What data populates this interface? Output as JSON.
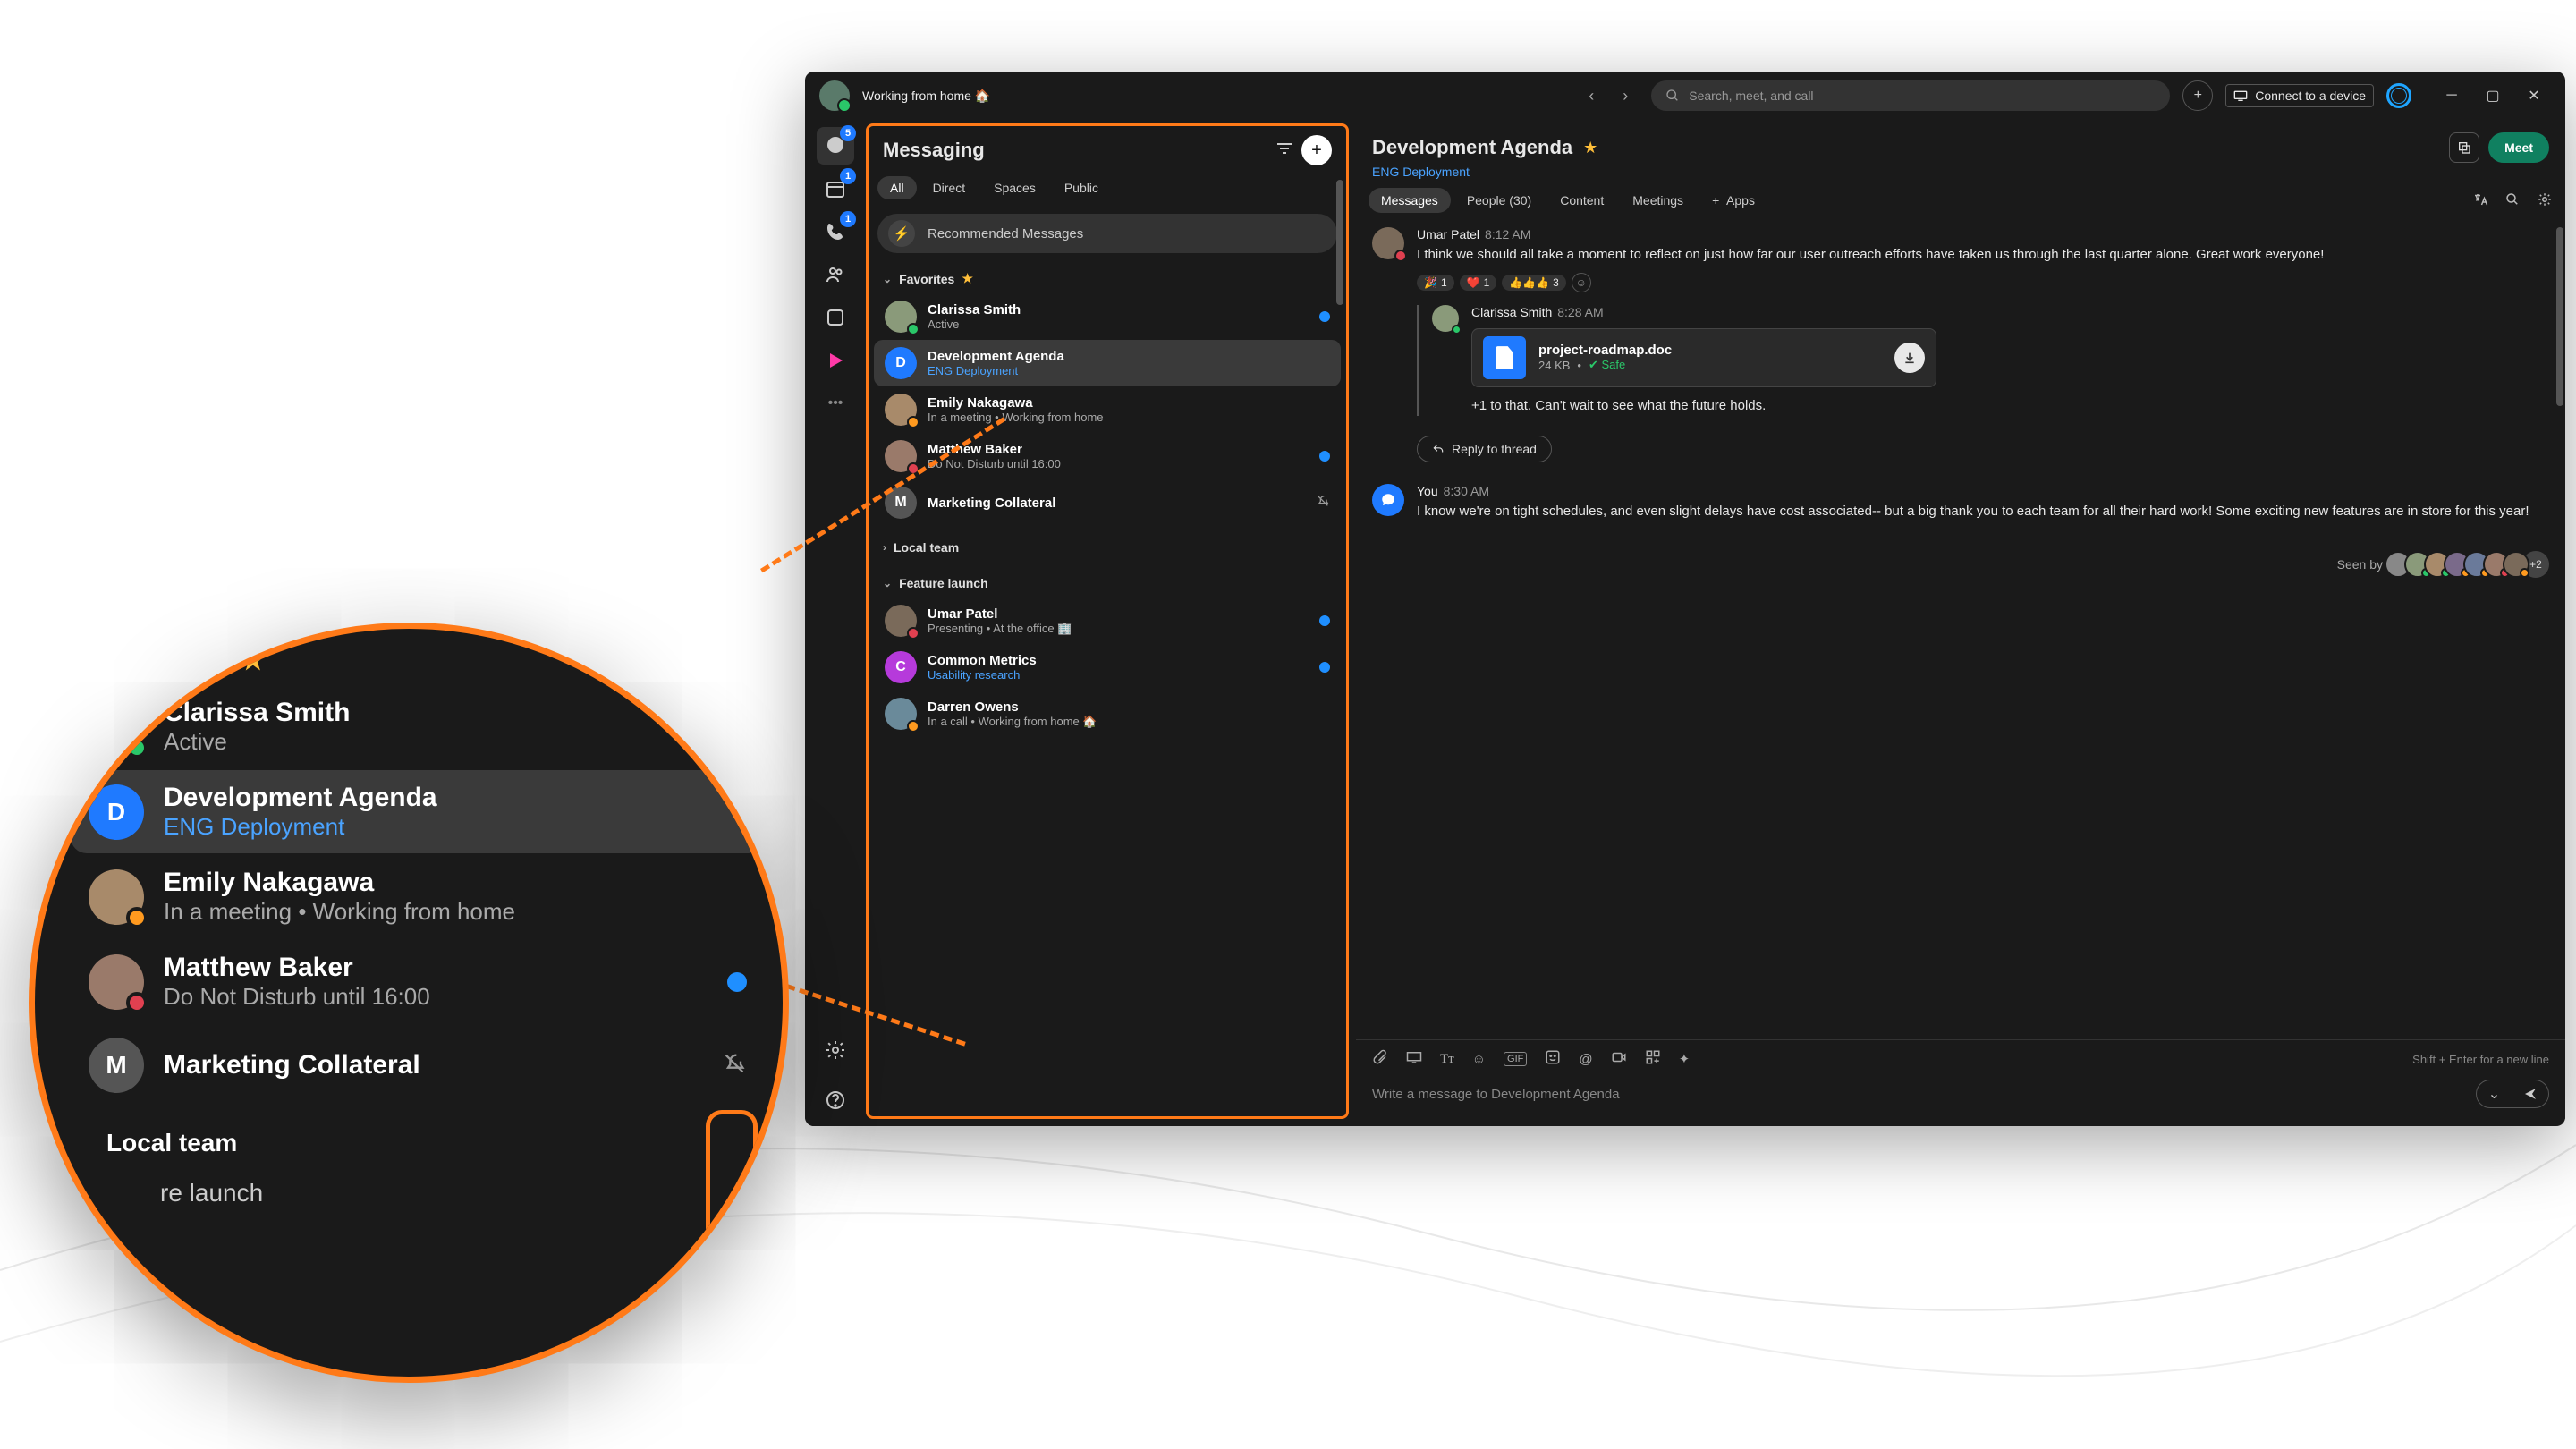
{
  "titlebar": {
    "status": "Working from home",
    "status_emoji": "🏠",
    "search_placeholder": "Search, meet, and call",
    "connect_label": "Connect to a device"
  },
  "rail": {
    "chat_badge": "5",
    "meetings_badge": "1",
    "calls_badge": "1"
  },
  "messaging": {
    "title": "Messaging",
    "tabs": {
      "all": "All",
      "direct": "Direct",
      "spaces": "Spaces",
      "public": "Public"
    },
    "recommended": "Recommended Messages",
    "sections": {
      "favorites": "Favorites",
      "local_team": "Local team",
      "feature_launch": "Feature launch"
    },
    "favorites": [
      {
        "name": "Clarissa Smith",
        "sub": "Active",
        "presence": "green"
      },
      {
        "name": "Development Agenda",
        "sub": "ENG Deployment",
        "sublink": true,
        "avatar_letter": "D",
        "avatar_color": "blue",
        "selected": true
      },
      {
        "name": "Emily Nakagawa",
        "sub": "In a meeting  •  Working from home",
        "presence": "orange"
      },
      {
        "name": "Matthew Baker",
        "sub": "Do Not Disturb until 16:00",
        "presence": "red",
        "dot": true
      },
      {
        "name": "Marketing Collateral",
        "sub": "",
        "avatar_letter": "M",
        "avatar_color": "gray",
        "muted": true
      }
    ],
    "feature_launch": [
      {
        "name": "Umar Patel",
        "sub": "Presenting  •  At the office 🏢",
        "presence": "red",
        "dot": true
      },
      {
        "name": "Common Metrics",
        "sub": "Usability research",
        "sublink": true,
        "avatar_letter": "C",
        "avatar_color": "purple",
        "dot": true
      },
      {
        "name": "Darren Owens",
        "sub": "In a call  •  Working from home 🏠",
        "presence": "orange"
      }
    ]
  },
  "conversation": {
    "title": "Development Agenda",
    "subtitle": "ENG Deployment",
    "meet_label": "Meet",
    "tabs": {
      "messages": "Messages",
      "people": "People (30)",
      "content": "Content",
      "meetings": "Meetings",
      "apps": "Apps"
    },
    "msg1": {
      "sender": "Umar Patel",
      "time": "8:12 AM",
      "text": "I think we should all take a moment to reflect on just how far our user outreach efforts have taken us through the last quarter alone. Great work everyone!",
      "reactions": [
        {
          "emoji": "🎉",
          "count": "1"
        },
        {
          "emoji": "❤️",
          "count": "1"
        },
        {
          "emoji": "👍👍👍",
          "count": "3"
        }
      ]
    },
    "reply1": {
      "sender": "Clarissa Smith",
      "time": "8:28 AM",
      "file": {
        "name": "project-roadmap.doc",
        "size": "24 KB",
        "safe_label": "Safe"
      },
      "text": "+1 to that. Can't wait to see what the future holds."
    },
    "reply_button": "Reply to thread",
    "msg2": {
      "sender": "You",
      "time": "8:30 AM",
      "text": "I know we're on tight schedules, and even slight delays have cost associated-- but a big thank you to each team for all their hard work! Some exciting new features are in store for this year!"
    },
    "seen_label": "Seen by",
    "seen_more": "+2",
    "composer_hint": "Shift + Enter for a new line",
    "composer_placeholder": "Write a message to Development Agenda"
  },
  "zoom": {
    "favorites_label": "vorites",
    "local_team": "Local team",
    "feature_launch": "re launch",
    "entries": [
      {
        "name": "Clarissa Smith",
        "sub": "Active",
        "presence": "green",
        "dot": true
      },
      {
        "name": "Development Agenda",
        "sub": "ENG Deployment",
        "sublink": true,
        "letter": "D",
        "selected": true
      },
      {
        "name": "Emily Nakagawa",
        "sub": "In a meeting  •  Working from home",
        "presence": "orange"
      },
      {
        "name": "Matthew Baker",
        "sub": "Do Not Disturb until 16:00",
        "presence": "red",
        "dot": true
      },
      {
        "name": "Marketing Collateral",
        "sub": "",
        "letter": "M",
        "muted": true
      }
    ]
  }
}
